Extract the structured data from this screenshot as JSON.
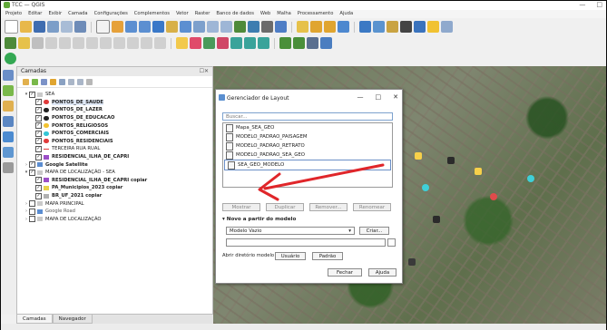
{
  "window": {
    "title": "TCC — QGIS",
    "controls": [
      "—",
      "□",
      "✕"
    ]
  },
  "menubar": [
    "Projeto",
    "Editar",
    "Exibir",
    "Camada",
    "Configurações",
    "Complementos",
    "Vetor",
    "Raster",
    "Banco de dados",
    "Web",
    "Malha",
    "Processamento",
    "Ajuda"
  ],
  "layers_panel": {
    "title": "Camadas",
    "controls": "☐✕",
    "rows": [
      {
        "indent": 1,
        "expand": "▾",
        "checked": true,
        "symbol": "group",
        "label": "SEA",
        "style": ""
      },
      {
        "indent": 2,
        "expand": "",
        "checked": true,
        "symbol": "point-red",
        "label": "PONTOS_DE_SAUDE",
        "style": "b sel"
      },
      {
        "indent": 2,
        "expand": "",
        "checked": true,
        "symbol": "point-dark",
        "label": "PONTOS_DE_LAZER",
        "style": "b"
      },
      {
        "indent": 2,
        "expand": "",
        "checked": true,
        "symbol": "point-dark",
        "label": "PONTOS_DE_EDUCACAO",
        "style": "b"
      },
      {
        "indent": 2,
        "expand": "",
        "checked": true,
        "symbol": "point-yellow",
        "label": "PONTOS_RELIGIOSOS",
        "style": "b"
      },
      {
        "indent": 2,
        "expand": "",
        "checked": true,
        "symbol": "point-cyan",
        "label": "PONTOS_COMERCIAIS",
        "style": "b"
      },
      {
        "indent": 2,
        "expand": "",
        "checked": true,
        "symbol": "point-red",
        "label": "PONTOS_RESIDENCIAIS",
        "style": "b"
      },
      {
        "indent": 2,
        "expand": "",
        "checked": true,
        "symbol": "line-red",
        "label": "TERCEIRA RUA RUAL",
        "style": ""
      },
      {
        "indent": 2,
        "expand": "",
        "checked": true,
        "symbol": "fill-purple",
        "label": "RESIDENCIAL_ILHA_DE_CAPRI",
        "style": "b"
      },
      {
        "indent": 1,
        "expand": "›",
        "checked": true,
        "symbol": "raster",
        "label": "Google Satellite",
        "style": "b"
      },
      {
        "indent": 1,
        "expand": "▾",
        "checked": true,
        "symbol": "group",
        "label": "MAPA DE LOCALIZAÇÃO - SEA",
        "style": ""
      },
      {
        "indent": 2,
        "expand": "",
        "checked": true,
        "symbol": "fill-purple",
        "label": "RESIDENCIAL_ILHA_DE_CAPRI copiar",
        "style": "b"
      },
      {
        "indent": 2,
        "expand": "",
        "checked": true,
        "symbol": "fill-yellow",
        "label": "PA_Municipios_2023 copiar",
        "style": "b"
      },
      {
        "indent": 2,
        "expand": "",
        "checked": true,
        "symbol": "fill-gray",
        "label": "BR_UF_2021 copiar",
        "style": "b"
      },
      {
        "indent": 1,
        "expand": "›",
        "checked": false,
        "symbol": "group",
        "label": "MAPA PRINCIPAL",
        "style": ""
      },
      {
        "indent": 1,
        "expand": "›",
        "checked": false,
        "symbol": "raster",
        "label": "Google Road",
        "style": "gray"
      },
      {
        "indent": 1,
        "expand": "›",
        "checked": false,
        "symbol": "group",
        "label": "MAPA DE LOCALIZAÇÃO",
        "style": ""
      }
    ],
    "tabs": [
      "Camadas",
      "Navegador"
    ]
  },
  "dialog": {
    "title": "Gerenciador de Layout",
    "controls": [
      "—",
      "□",
      "✕"
    ],
    "search_placeholder": "Buscar...",
    "layouts": [
      "Mapa_SEA_GEO",
      "MODELO_PADRAO_PAISAGEM",
      "MODELO_PADRAO_RETRATO",
      "MODELO_PADRAO_SEA_GEO",
      "SEA_GEO_MODELO"
    ],
    "selected_index": 4,
    "buttons": {
      "show": "Mostrar",
      "duplicate": "Duplicar",
      "remove": "Remover...",
      "rename": "Renomear"
    },
    "new_section": "Novo a partir do modelo",
    "template_value": "Modelo Vazio",
    "create_label": "Criar...",
    "open_dir_label": "Abrir diretório modelo",
    "user_label": "Usuário",
    "default_label": "Padrão",
    "close_label": "Fechar",
    "help_label": "Ajuda"
  },
  "colors": {
    "arrow": "#e0262a",
    "selection": "#6b8fc7",
    "accent": "#61a83a"
  }
}
